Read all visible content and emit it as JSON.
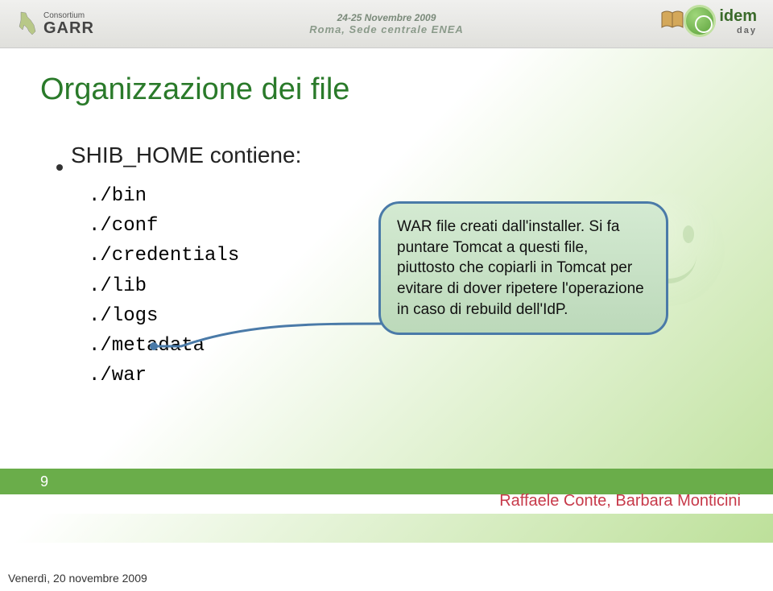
{
  "header": {
    "consortium_small": "Consortium",
    "consortium_big": "GARR",
    "dates": "24-25 Novembre 2009",
    "place": "Roma, Sede centrale ENEA",
    "idem": "idem",
    "idem_sub": "day"
  },
  "slide": {
    "title": "Organizzazione dei file",
    "bullet": "SHIB_HOME contiene:",
    "paths": [
      "./bin",
      "./conf",
      "./credentials",
      "./lib",
      "./logs",
      "./metadata",
      "./war"
    ],
    "callout": "WAR file creati dall'installer. Si fa puntare Tomcat a questi file, piuttosto che copiarli in Tomcat per evitare di dover ripetere l'operazione in caso di rebuild dell'IdP."
  },
  "footer": {
    "page": "9",
    "authors": "Raffaele Conte, Barbara Monticini",
    "date": "Venerdì, 20 novembre 2009"
  }
}
